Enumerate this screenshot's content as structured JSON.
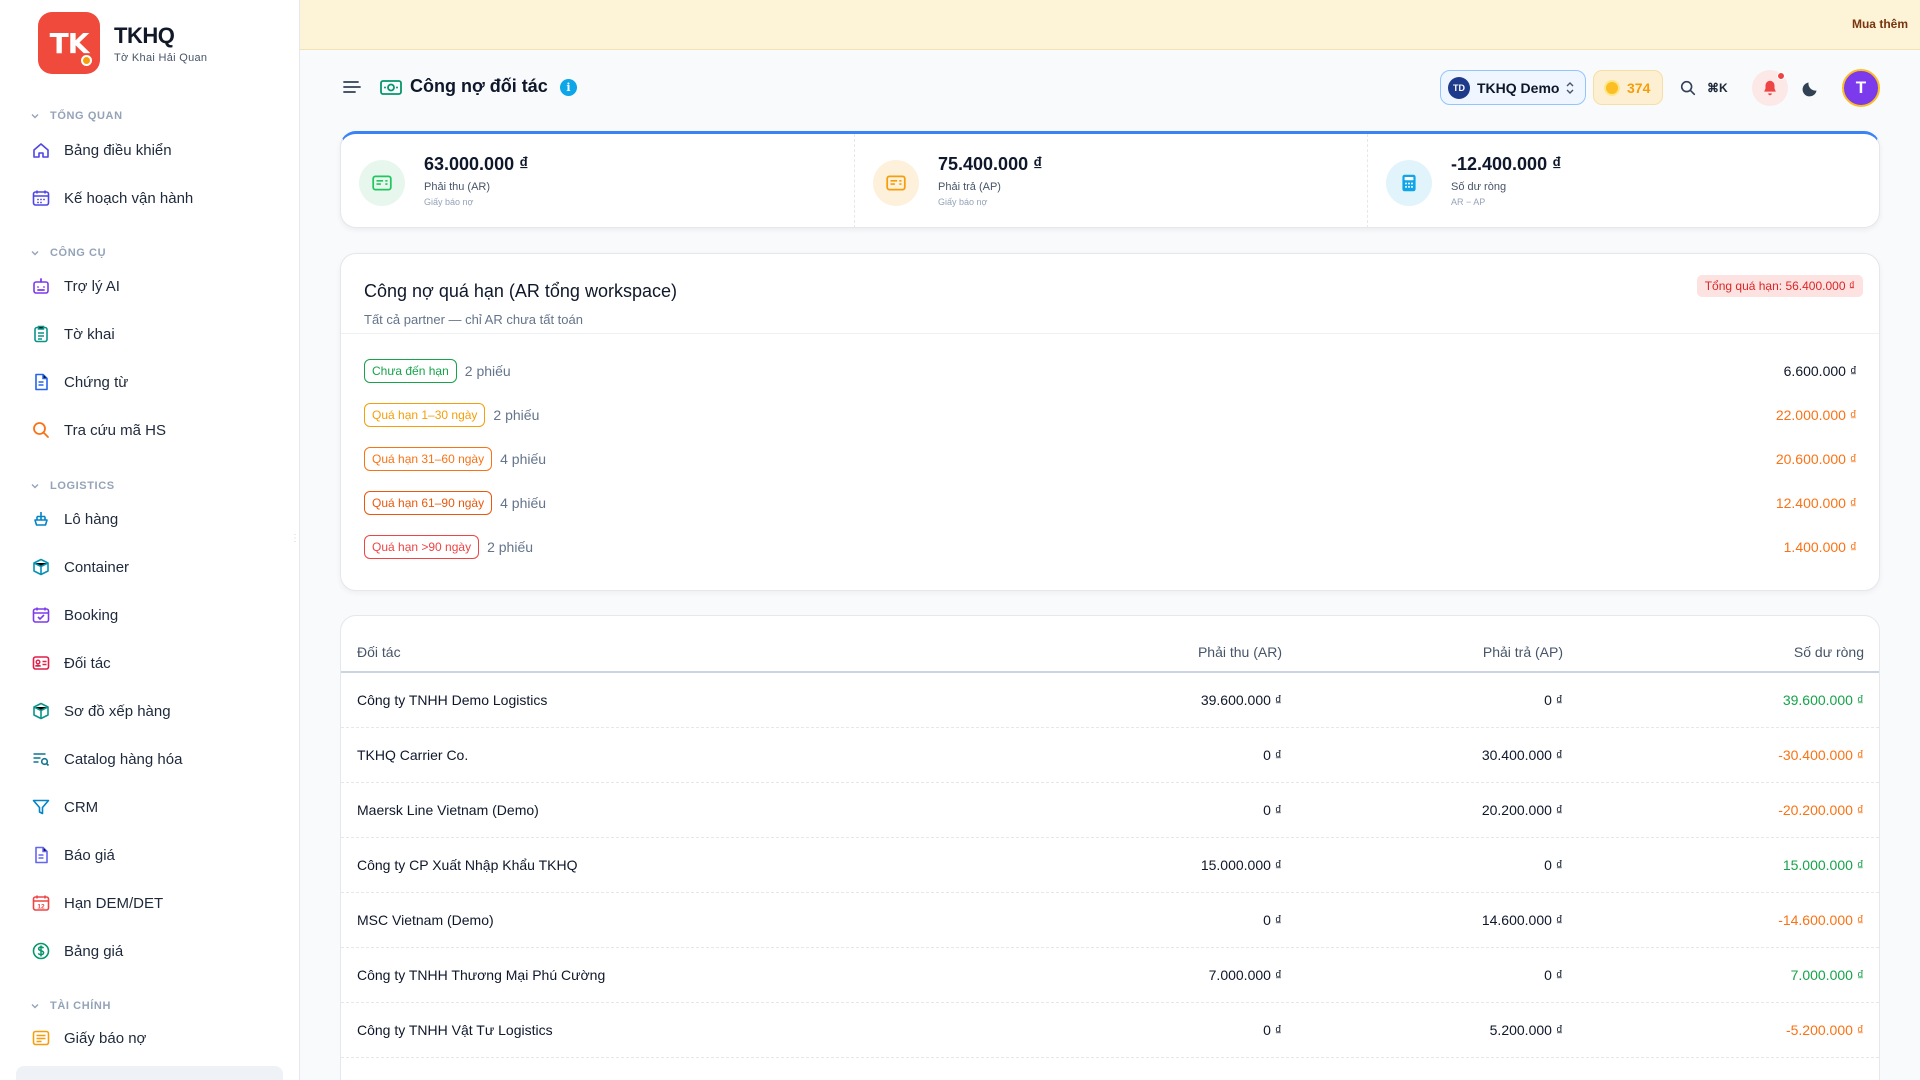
{
  "brand": {
    "logo_text": "TK",
    "name": "TKHQ",
    "subtitle": "Tờ Khai Hải Quan"
  },
  "sidebar": {
    "sections": [
      {
        "label": "TỔNG QUAN",
        "items": [
          {
            "label": "Bảng điều khiển",
            "icon": "home-icon"
          },
          {
            "label": "Kế hoạch vận hành",
            "icon": "calendar-grid-icon"
          }
        ]
      },
      {
        "label": "CÔNG CỤ",
        "items": [
          {
            "label": "Trợ lý AI",
            "icon": "robot-icon"
          },
          {
            "label": "Tờ khai",
            "icon": "clipboard-icon"
          },
          {
            "label": "Chứng từ",
            "icon": "document-icon"
          },
          {
            "label": "Tra cứu mã HS",
            "icon": "search-icon"
          }
        ]
      },
      {
        "label": "LOGISTICS",
        "items": [
          {
            "label": "Lô hàng",
            "icon": "ship-icon"
          },
          {
            "label": "Container",
            "icon": "box-icon"
          },
          {
            "label": "Booking",
            "icon": "calendar-check-icon"
          },
          {
            "label": "Đối tác",
            "icon": "contact-card-icon"
          },
          {
            "label": "Sơ đồ xếp hàng",
            "icon": "cube-icon"
          },
          {
            "label": "Catalog hàng hóa",
            "icon": "list-search-icon"
          },
          {
            "label": "CRM",
            "icon": "funnel-icon"
          },
          {
            "label": "Báo giá",
            "icon": "quote-file-icon"
          },
          {
            "label": "Hạn DEM/DET",
            "icon": "calendar-12-icon"
          },
          {
            "label": "Bảng giá",
            "icon": "dollar-circle-icon"
          }
        ]
      },
      {
        "label": "TÀI CHÍNH",
        "items": [
          {
            "label": "Giấy báo nợ",
            "icon": "invoice-icon"
          }
        ]
      }
    ]
  },
  "promo": {
    "cta": "Mua thêm"
  },
  "header": {
    "title": "Công nợ đối tác",
    "workspace_badge": "TD",
    "workspace_name": "TKHQ Demo",
    "credits": "374",
    "search_shortcut": "⌘K",
    "avatar_initial": "T"
  },
  "stats": [
    {
      "value": "63.000.000 ₫",
      "label": "Phải thu (AR)",
      "sub": "Giấy báo nợ",
      "color": "#22c55e",
      "bg": "#e8f7ee"
    },
    {
      "value": "75.400.000 ₫",
      "label": "Phải trả (AP)",
      "sub": "Giấy báo nợ",
      "color": "#f59e0b",
      "bg": "#fdf1dc"
    },
    {
      "value": "-12.400.000 ₫",
      "label": "Số dư ròng",
      "sub": "AR − AP",
      "color": "#0ea5e9",
      "bg": "#e1f3fb"
    }
  ],
  "overdue": {
    "title": "Công nợ quá hạn (AR tổng workspace)",
    "subtitle": "Tất cả partner — chỉ AR chưa tất toán",
    "total": "Tổng quá hạn: 56.400.000 ₫",
    "buckets": [
      {
        "label": "Chưa đến hạn",
        "count": "2 phiếu",
        "amount": "6.600.000 ₫",
        "color": "#16a34a",
        "amount_color": "#0f172a"
      },
      {
        "label": "Quá hạn 1–30 ngày",
        "count": "2 phiếu",
        "amount": "22.000.000 ₫",
        "color": "#f59e0b",
        "amount_color": "#f97316"
      },
      {
        "label": "Quá hạn 31–60 ngày",
        "count": "4 phiếu",
        "amount": "20.600.000 ₫",
        "color": "#f97316",
        "amount_color": "#f97316"
      },
      {
        "label": "Quá hạn 61–90 ngày",
        "count": "4 phiếu",
        "amount": "12.400.000 ₫",
        "color": "#ea580c",
        "amount_color": "#f97316"
      },
      {
        "label": "Quá hạn >90 ngày",
        "count": "2 phiếu",
        "amount": "1.400.000 ₫",
        "color": "#ef4444",
        "amount_color": "#f97316"
      }
    ]
  },
  "table": {
    "columns": [
      "Đối tác",
      "Phải thu (AR)",
      "Phải trả (AP)",
      "Số dư ròng"
    ],
    "rows": [
      {
        "partner": "Công ty TNHH Demo Logistics",
        "ar": "39.600.000 ₫",
        "ap": "0 ₫",
        "net": "39.600.000 ₫",
        "sign": "pos"
      },
      {
        "partner": "TKHQ Carrier Co.",
        "ar": "0 ₫",
        "ap": "30.400.000 ₫",
        "net": "-30.400.000 ₫",
        "sign": "neg"
      },
      {
        "partner": "Maersk Line Vietnam (Demo)",
        "ar": "0 ₫",
        "ap": "20.200.000 ₫",
        "net": "-20.200.000 ₫",
        "sign": "neg"
      },
      {
        "partner": "Công ty CP Xuất Nhập Khẩu TKHQ",
        "ar": "15.000.000 ₫",
        "ap": "0 ₫",
        "net": "15.000.000 ₫",
        "sign": "pos"
      },
      {
        "partner": "MSC Vietnam (Demo)",
        "ar": "0 ₫",
        "ap": "14.600.000 ₫",
        "net": "-14.600.000 ₫",
        "sign": "neg"
      },
      {
        "partner": "Công ty TNHH Thương Mại Phú Cường",
        "ar": "7.000.000 ₫",
        "ap": "0 ₫",
        "net": "7.000.000 ₫",
        "sign": "pos"
      },
      {
        "partner": "Công ty TNHH Vật Tư Logistics",
        "ar": "0 ₫",
        "ap": "5.200.000 ₫",
        "net": "-5.200.000 ₫",
        "sign": "neg"
      }
    ]
  }
}
